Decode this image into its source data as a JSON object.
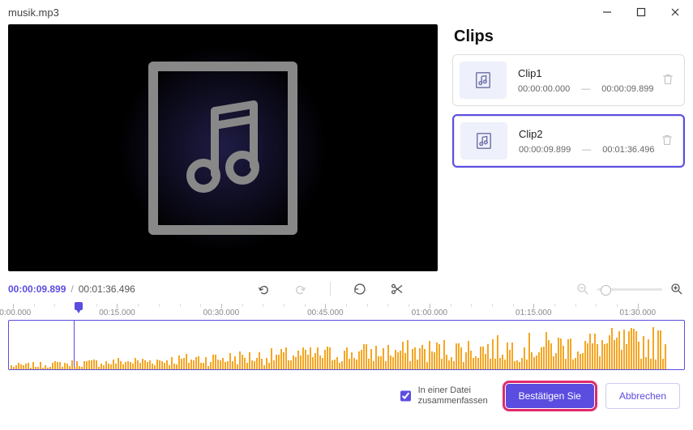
{
  "window": {
    "title": "musik.mp3"
  },
  "preview": {
    "icon": "music-note-icon"
  },
  "clips": {
    "title": "Clips",
    "items": [
      {
        "name": "Clip1",
        "start": "00:00:00.000",
        "end": "00:00:09.899",
        "selected": false
      },
      {
        "name": "Clip2",
        "start": "00:00:09.899",
        "end": "00:01:36.496",
        "selected": true
      }
    ]
  },
  "timeline": {
    "current": "00:00:09.899",
    "total": "00:01:36.496",
    "labels": [
      "00:00.000",
      "00:15.000",
      "00:30.000",
      "00:45.000",
      "01:00.000",
      "01:15.000",
      "01:30.000"
    ]
  },
  "footer": {
    "merge_label": "In einer Datei zusammenfassen",
    "merge_checked": true,
    "confirm": "Bestätigen Sie",
    "cancel": "Abbrechen"
  },
  "colors": {
    "accent": "#5b4de0",
    "wave": "#f5a623",
    "highlight": "#e02a6a"
  }
}
